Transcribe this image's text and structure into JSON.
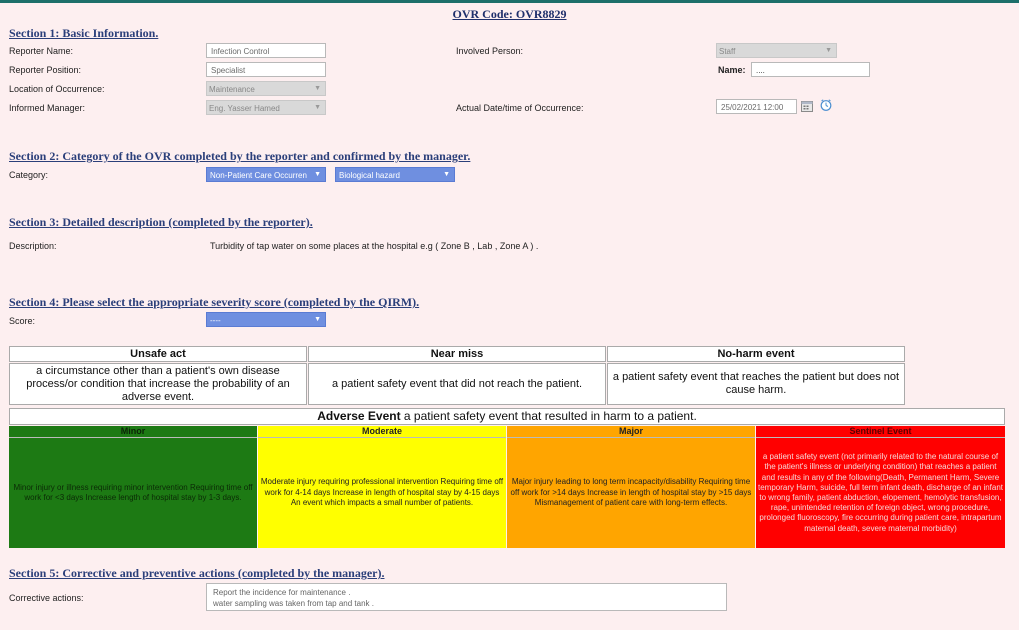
{
  "ovr_code": "OVR Code: OVR8829",
  "section1": {
    "title": "Section 1: Basic Information.",
    "reporter_name_label": "Reporter Name:",
    "reporter_name_value": "Infection Control",
    "reporter_position_label": "Reporter Position:",
    "reporter_position_value": "Specialist",
    "location_label": "Location of Occurrence:",
    "location_value": "Maintenance",
    "manager_label": "Informed Manager:",
    "manager_value": "Eng. Yasser Hamed",
    "involved_label": "Involved Person:",
    "involved_value": "Staff",
    "name_label": "Name:",
    "name_value": "....",
    "datetime_label": "Actual Date/time of Occurrence:",
    "datetime_value": "25/02/2021 12:00"
  },
  "section2": {
    "title": "Section 2: Category of the OVR completed by the reporter and confirmed by the manager.",
    "category_label": "Category:",
    "category_value": "Non-Patient Care Occurren",
    "subcategory_value": "Biological hazard"
  },
  "section3": {
    "title": "Section 3: Detailed description (completed by the reporter).",
    "description_label": "Description:",
    "description_value": "Turbidity of tap water on some places at the hospital e.g ( Zone B , Lab , Zone A ) ."
  },
  "section4": {
    "title": "Section 4: Please select the appropriate severity score (completed by the QIRM).",
    "score_label": "Score:",
    "score_value": "----",
    "unsafe_act_title": "Unsafe act",
    "unsafe_act_desc": "a circumstance other than a patient's own disease process/or condition that increase the probability of an adverse event.",
    "near_miss_title": "Near miss",
    "near_miss_desc": "a patient safety event that did not reach the patient.",
    "no_harm_title": "No-harm event",
    "no_harm_desc": "a patient safety event that reaches the patient but does not cause harm.",
    "adverse_title": "Adverse Event",
    "adverse_desc": " a patient safety event that resulted in harm to a patient.",
    "minor_title": "Minor",
    "minor_desc": "Minor injury or illness requiring minor intervention Requiring time off work for <3 days Increase length of hospital stay by 1-3 days.",
    "moderate_title": "Moderate",
    "moderate_desc": "Moderate injury requiring professional intervention Requiring time off work for 4-14 days Increase in length of hospital stay by 4-15 days An event which impacts a small number of patients.",
    "major_title": "Major",
    "major_desc": "Major injury leading to long term incapacity/disability Requiring time off work for >14 days Increase in length of hospital stay by >15 days Mismanagement of patient care with long-term effects.",
    "sentinel_title": "Sentinel Event",
    "sentinel_desc": "a patient safety event (not primarily related to the natural course of the patient's illness or underlying condition) that reaches a patient and results in any of the following(Death, Permanent Harm, Severe temporary Harm, suicide, full term infant death, discharge of an infant to wrong family, patient abduction, elopement, hemolytic transfusion, rape, unintended retention of foreign object, wrong procedure, prolonged fluoroscopy, fire occurring during patient care, intrapartum maternal death, severe maternal morbidity)"
  },
  "section5": {
    "title": "Section 5: Corrective and preventive actions (completed by the manager).",
    "corrective_label": "Corrective actions:",
    "corrective_line1": "Report the incidence for maintenance .",
    "corrective_line2": "water sampling was taken from tap and tank ."
  },
  "colors": {
    "minor": "#1d7a14",
    "moderate": "#ffff00",
    "major": "#ffa500",
    "sentinel": "#ff0000"
  }
}
